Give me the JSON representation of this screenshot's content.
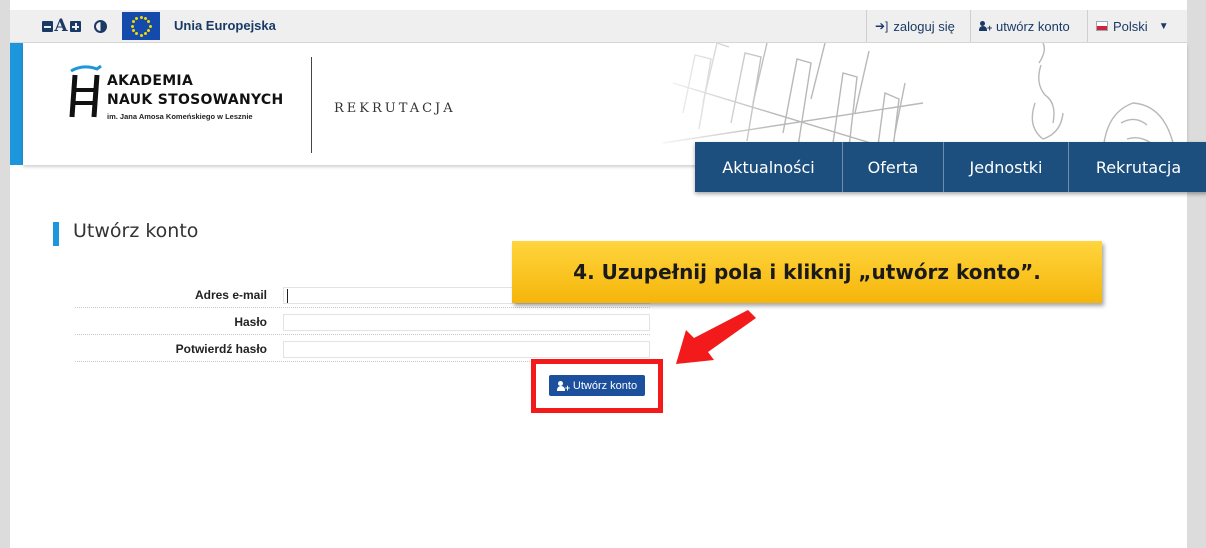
{
  "accessibility": {
    "font_smaller_label": "decrease-font",
    "font_letter": "A",
    "font_larger_label": "increase-font",
    "contrast_icon": "contrast-icon"
  },
  "topbar": {
    "eu_label": "Unia Europejska",
    "login_label": "zaloguj się",
    "create_account_label": "utwórz konto",
    "language_label": "Polski"
  },
  "header": {
    "logo_line1": "AKADEMIA",
    "logo_line2": "NAUK STOSOWANYCH",
    "logo_line3": "im. Jana Amosa Komeńskiego w Lesznie",
    "title": "REKRUTACJA"
  },
  "nav": {
    "items": [
      {
        "label": "Aktualności"
      },
      {
        "label": "Oferta"
      },
      {
        "label": "Jednostki"
      },
      {
        "label": "Rekrutacja"
      }
    ]
  },
  "main": {
    "section_title": "Utwórz konto",
    "form": {
      "email_label": "Adres e-mail",
      "email_value": "",
      "password_label": "Hasło",
      "password_value": "",
      "confirm_label": "Potwierdź hasło",
      "confirm_value": "",
      "submit_label": "Utwórz konto"
    }
  },
  "callout": {
    "text": "4. Uzupełnij pola i kliknij „utwórz konto”."
  },
  "colors": {
    "nav_bg": "#1c4f7d",
    "accent_blue": "#1e96db",
    "button_blue": "#1c4f9c",
    "callout_yellow": "#f5b50a",
    "highlight_red": "#f21a1a"
  }
}
